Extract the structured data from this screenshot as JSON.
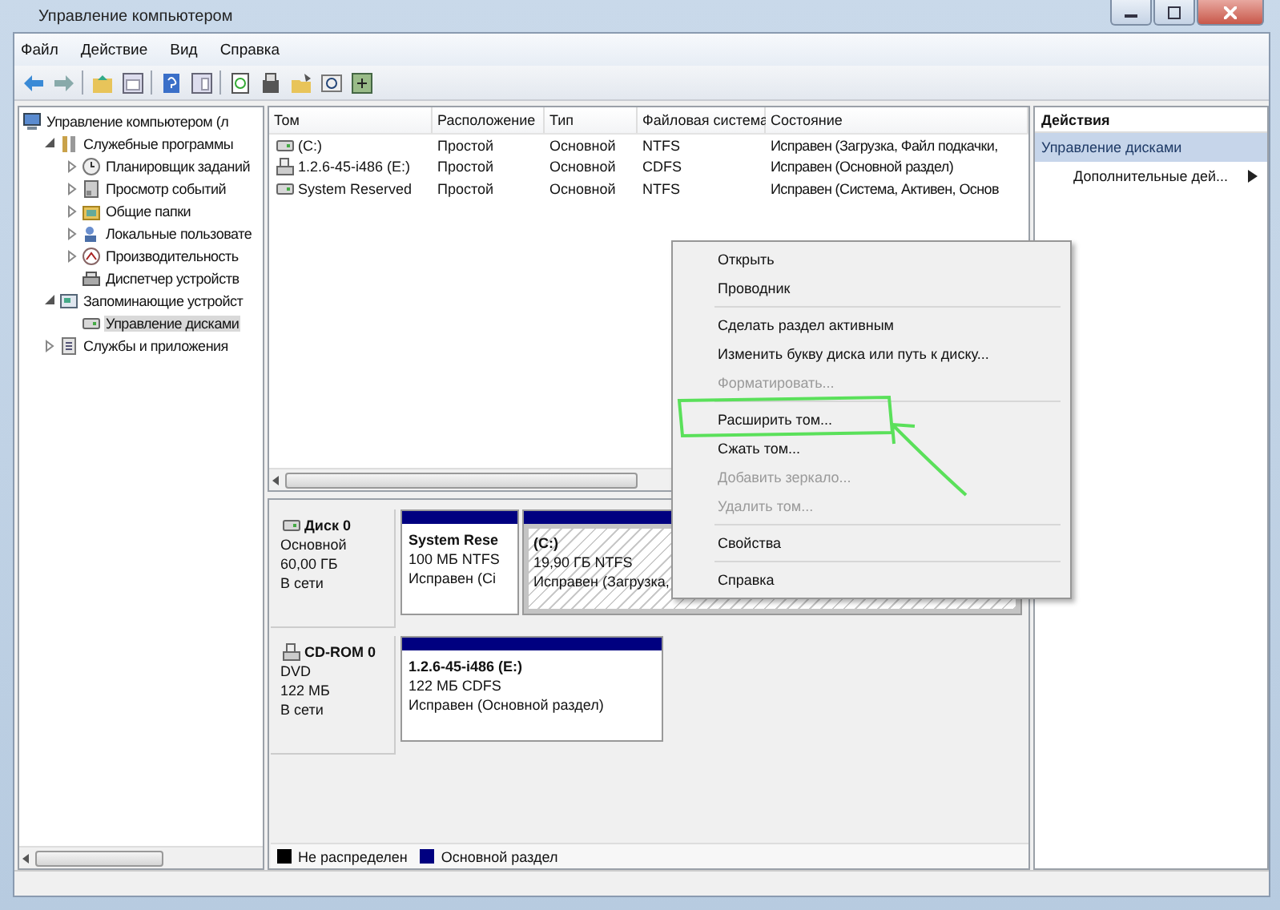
{
  "window": {
    "title": "Управление компьютером"
  },
  "menu": [
    "Файл",
    "Действие",
    "Вид",
    "Справка"
  ],
  "tree": [
    {
      "label": "Управление компьютером (л",
      "kind": "computer",
      "selected": false,
      "children": [
        {
          "label": "Служебные программы",
          "kind": "tools",
          "expanded": true,
          "selected": false,
          "children": [
            {
              "label": "Планировщик заданий",
              "kind": "clock",
              "expanded": false,
              "selected": false
            },
            {
              "label": "Просмотр событий",
              "kind": "log",
              "expanded": false,
              "selected": false
            },
            {
              "label": "Общие папки",
              "kind": "folder",
              "expanded": false,
              "selected": false
            },
            {
              "label": "Локальные пользовате",
              "kind": "users",
              "expanded": false,
              "selected": false
            },
            {
              "label": "Производительность",
              "kind": "perf",
              "expanded": false,
              "selected": false
            },
            {
              "label": "Диспетчер устройств",
              "kind": "device",
              "selected": false
            }
          ]
        },
        {
          "label": "Запоминающие устройст",
          "kind": "storage",
          "expanded": true,
          "selected": false,
          "children": [
            {
              "label": "Управление дисками",
              "kind": "disk",
              "selected": true
            }
          ]
        },
        {
          "label": "Службы и приложения",
          "kind": "services",
          "expanded": false,
          "selected": false
        }
      ]
    }
  ],
  "volumes": {
    "columns": [
      "Том",
      "Расположение",
      "Тип",
      "Файловая система",
      "Состояние"
    ],
    "rows": [
      {
        "kind": "disk",
        "cells": [
          "(C:)",
          "Простой",
          "Основной",
          "NTFS",
          "Исправен (Загрузка, Файл подкачки,"
        ]
      },
      {
        "kind": "cdrom",
        "cells": [
          "1.2.6-45-i486 (E:)",
          "Простой",
          "Основной",
          "CDFS",
          "Исправен (Основной раздел)"
        ]
      },
      {
        "kind": "disk",
        "cells": [
          "System Reserved",
          "Простой",
          "Основной",
          "NTFS",
          "Исправен (Система, Активен, Основ"
        ]
      }
    ]
  },
  "disks": [
    {
      "kind": "disk",
      "name": "Диск 0",
      "lines": [
        "Основной",
        "60,00 ГБ",
        "В сети"
      ],
      "partitions": [
        {
          "title": "System Rese",
          "size": "100 МБ NTFS",
          "status": "Исправен (Сі",
          "selected": false
        },
        {
          "title": "(C:)",
          "size": "19,90 ГБ NTFS",
          "status": "Исправен (Загрузка,",
          "selected": true
        }
      ]
    },
    {
      "kind": "cdrom",
      "name": "CD-ROM 0",
      "lines": [
        "DVD",
        "122 МБ",
        "В сети"
      ],
      "partitions": [
        {
          "title": "1.2.6-45-i486  (E:)",
          "size": "122 МБ CDFS",
          "status": "Исправен (Основной раздел)",
          "selected": false
        }
      ]
    }
  ],
  "legend": [
    {
      "label": "Не распределен",
      "color": "#000000"
    },
    {
      "label": "Основной раздел",
      "color": "#000080"
    }
  ],
  "actions": {
    "title": "Действия",
    "section": "Управление дисками",
    "items": [
      {
        "label": "Дополнительные дей...",
        "kind": "submenu"
      }
    ]
  },
  "context_menu": [
    [
      {
        "label": "Открыть",
        "disabled": false
      },
      {
        "label": "Проводник",
        "disabled": false
      }
    ],
    [
      {
        "label": "Сделать раздел активным",
        "disabled": false
      },
      {
        "label": "Изменить букву диска или путь к диску...",
        "disabled": false
      },
      {
        "label": "Форматировать...",
        "disabled": true
      }
    ],
    [
      {
        "label": "Расширить том...",
        "disabled": false
      },
      {
        "label": "Сжать том...",
        "disabled": false
      },
      {
        "label": "Добавить зеркало...",
        "disabled": true
      },
      {
        "label": "Удалить том...",
        "disabled": true
      }
    ],
    [
      {
        "label": "Свойства",
        "disabled": false
      }
    ],
    [
      {
        "label": "Справка",
        "disabled": false
      }
    ]
  ]
}
